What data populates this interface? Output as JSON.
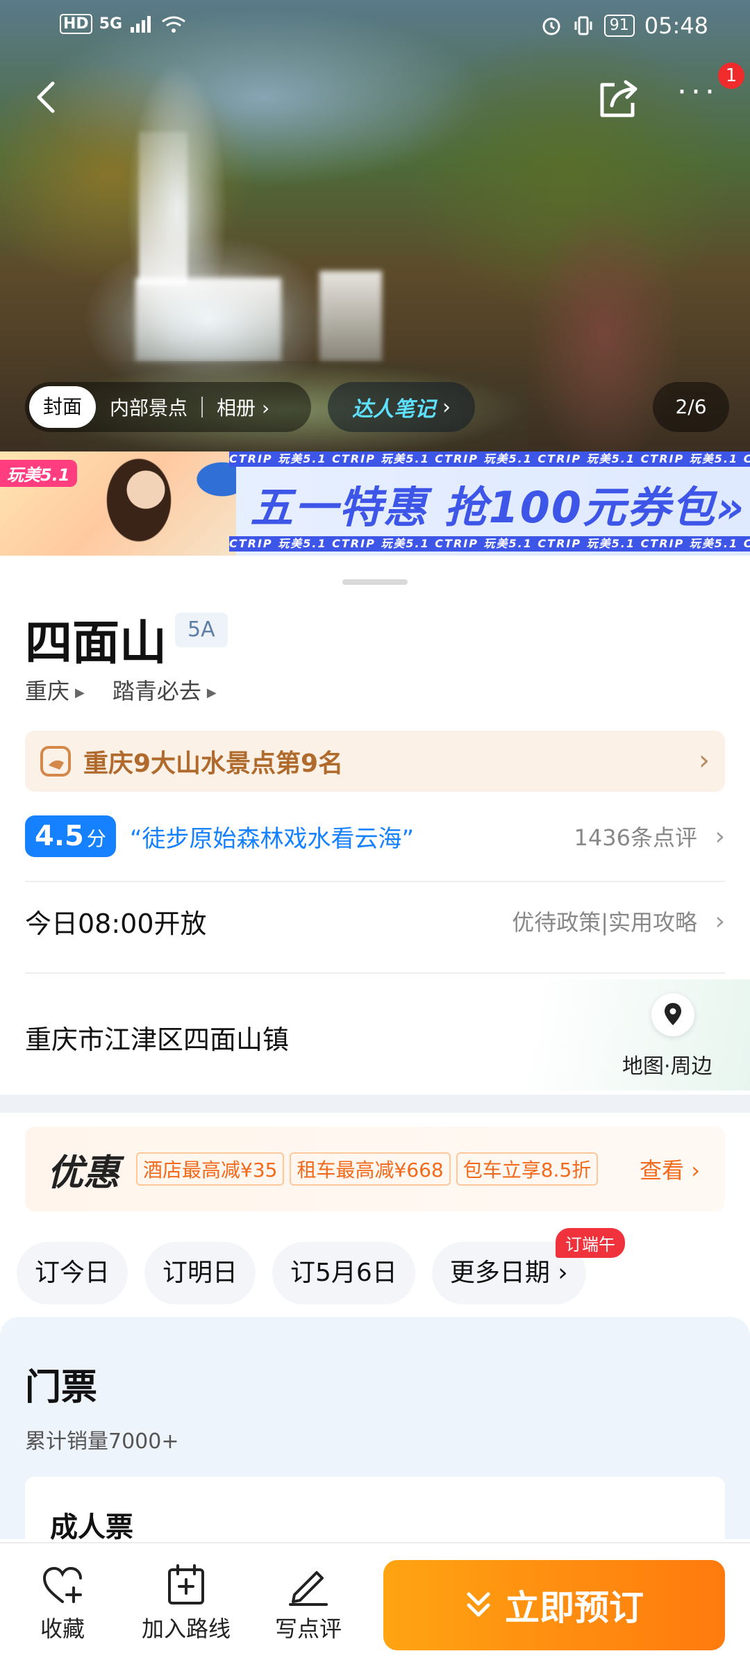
{
  "status_bar": {
    "left_labels": [
      "HD",
      "5G"
    ],
    "battery": "91",
    "time": "05:48"
  },
  "hero": {
    "notification_count": "1",
    "tabs": [
      "封面",
      "内部景点",
      "相册"
    ],
    "talent_notes": "达人笔记",
    "counter": "2/6"
  },
  "banner": {
    "tag": "玩美5.1",
    "ticker_text": "CTRIP  玩美5.1  CTRIP  玩美5.1  CTRIP  玩美5.1  CTRIP  玩美5.1  CTRIP  玩美5.1  CTRIP",
    "headline": "五一特惠 抢100元券包»"
  },
  "attraction": {
    "name": "四面山",
    "level": "5A",
    "breadcrumbs": [
      "重庆",
      "踏青必去"
    ],
    "rank": "重庆9大山水景点第9名",
    "score": "4.5",
    "score_unit": "分",
    "quote": "“徒步原始森林戏水看云海”",
    "review_count": "1436条点评",
    "hours": "今日08:00开放",
    "policy_links": "优待政策|实用攻略",
    "address": "重庆市江津区四面山镇",
    "map_label": "地图·周边"
  },
  "promo": {
    "title": "优惠",
    "tags": [
      "酒店最高减¥35",
      "租车最高减¥668",
      "包车立享8.5折"
    ],
    "view": "查看"
  },
  "date_chips": [
    "订今日",
    "订明日",
    "订5月6日",
    "更多日期"
  ],
  "date_badge": "订端午",
  "tickets": {
    "title": "门票",
    "sales": "累计销量7000+",
    "first_ticket": "成人票"
  },
  "bottom_bar": {
    "favorite": "收藏",
    "add_route": "加入路线",
    "write_review": "写点评",
    "book_now": "立即预订"
  },
  "colors": {
    "brand_blue": "#1581ff",
    "accent_orange": "#ff7a0e",
    "rank_brown": "#b06a2c",
    "promo_orange": "#f26a1b",
    "badge_red": "#f02b2b"
  }
}
